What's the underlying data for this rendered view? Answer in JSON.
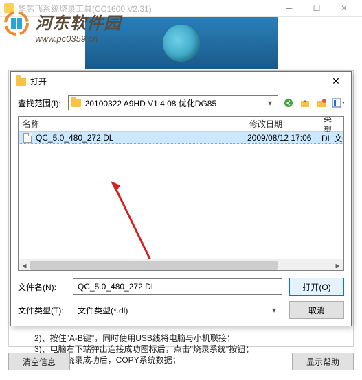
{
  "window": {
    "title": "华芯飞系统烧录工具(CC1600 V2.31)"
  },
  "watermark": {
    "cn": "河东软件园",
    "url": "www.pc0359.cn"
  },
  "instructions": {
    "line1": "2)、按住\"A-B键\"，同时使用USB线将电脑与小机联接；",
    "line2": "3)、电脑右下端弹出连接成功图标后，点击\"烧录系统\"按钮；",
    "line3": "4)、提示烧录成功后，COPY系统数据；"
  },
  "bottom": {
    "clear": "清空信息",
    "help": "显示帮助"
  },
  "dialog": {
    "title": "打开",
    "lookin_label": "查找范围(I):",
    "path": "20100322 A9HD V1.4.08 优化DG85",
    "columns": {
      "name": "名称",
      "date": "修改日期",
      "type": "类型"
    },
    "col_widths": {
      "name": 330,
      "date": 108,
      "type": 60
    },
    "file": {
      "name": "QC_5.0_480_272.DL",
      "date": "2009/08/12 17:06",
      "type": "DL 文件"
    },
    "filename_label": "文件名(N):",
    "filename_value": "QC_5.0_480_272.DL",
    "filetype_label": "文件类型(T):",
    "filetype_value": "文件类型(*.dl)",
    "open_btn": "打开(O)",
    "cancel_btn": "取消"
  }
}
